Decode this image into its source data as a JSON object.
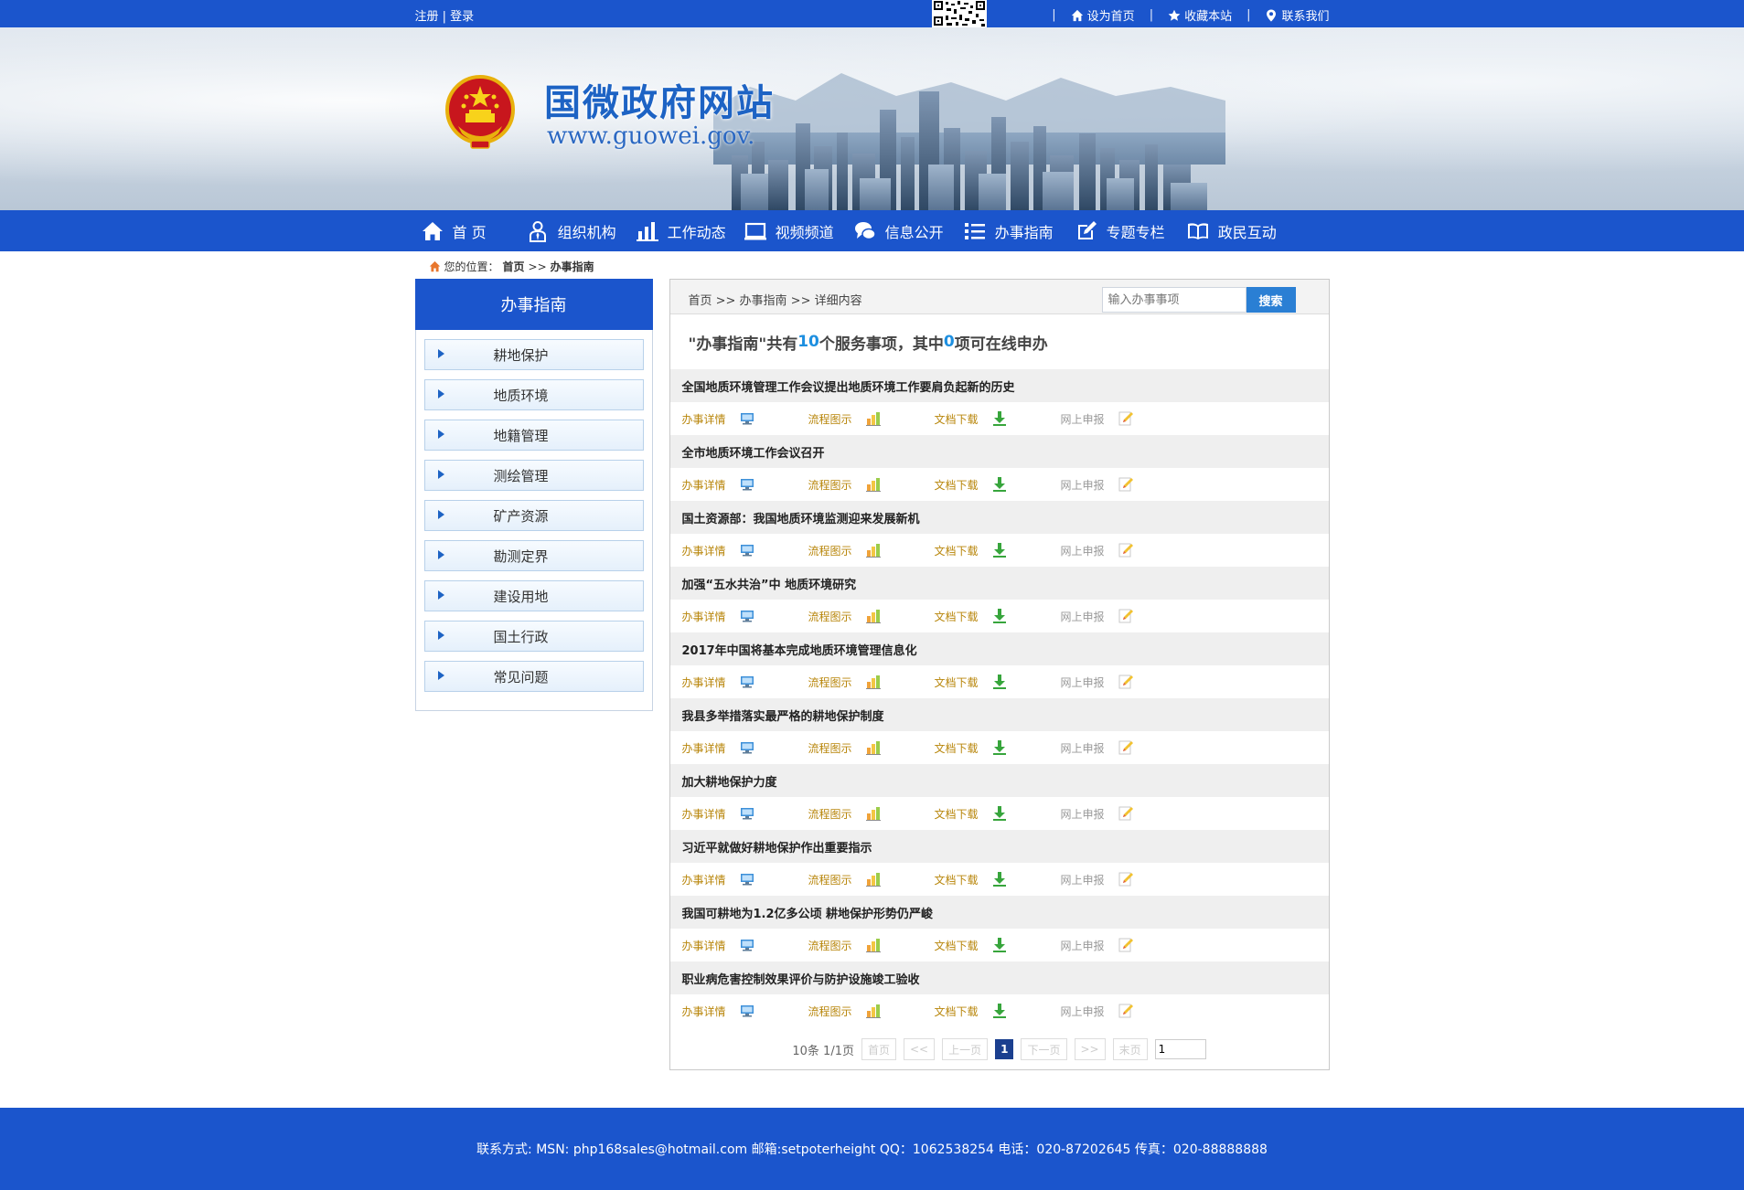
{
  "topbar": {
    "register": "注册",
    "separator": " | ",
    "login": "登录",
    "set_home": "设为首页",
    "favorite": "收藏本站",
    "contact": "联系我们",
    "divider": "|"
  },
  "banner": {
    "site_title": "国微政府网站",
    "site_url": "www.guowei.gov."
  },
  "nav": {
    "items": [
      {
        "label": "首 页",
        "icon": "home-icon"
      },
      {
        "label": "组织机构",
        "icon": "user-icon"
      },
      {
        "label": "工作动态",
        "icon": "bar-chart-icon"
      },
      {
        "label": "视频频道",
        "icon": "monitor-icon"
      },
      {
        "label": "信息公开",
        "icon": "chat-icon"
      },
      {
        "label": "办事指南",
        "icon": "list-icon"
      },
      {
        "label": "专题专栏",
        "icon": "edit-icon"
      },
      {
        "label": "政民互动",
        "icon": "book-icon"
      }
    ]
  },
  "breadcrumb": {
    "prefix": "您的位置：",
    "home": "首页",
    "sep": " >> ",
    "current": "办事指南"
  },
  "sidebar": {
    "title": "办事指南",
    "items": [
      "耕地保护",
      "地质环境",
      "地籍管理",
      "测绘管理",
      "矿产资源",
      "勘测定界",
      "建设用地",
      "国土行政",
      "常见问题"
    ]
  },
  "main": {
    "path": "首页 >> 办事指南 >> 详细内容",
    "search_placeholder": "输入办事事项",
    "search_button": "搜索",
    "summary": {
      "part1": "\"办事指南\"共有",
      "total": "10",
      "part2": "个服务事项，其中 ",
      "online": "0",
      "part3": "项可在线申办"
    },
    "action_labels": {
      "detail": "办事详情",
      "flow": "流程图示",
      "download": "文档下载",
      "online": "网上申报"
    },
    "items": [
      "全国地质环境管理工作会议提出地质环境工作要肩负起新的历史",
      "全市地质环境工作会议召开",
      "国土资源部：我国地质环境监测迎来发展新机",
      "加强“五水共治”中 地质环境研究",
      "2017年中国将基本完成地质环境管理信息化",
      "我县多举措落实最严格的耕地保护制度",
      "加大耕地保护力度",
      "习近平就做好耕地保护作出重要指示",
      "我国可耕地为1.2亿多公顷 耕地保护形势仍严峻",
      "职业病危害控制效果评价与防护设施竣工验收"
    ]
  },
  "pager": {
    "info": "10条 1/1页",
    "first": "首页",
    "prev_fast": "<<",
    "prev": "上一页",
    "current": "1",
    "next": "下一页",
    "next_fast": ">>",
    "last": "末页",
    "jump_value": "1"
  },
  "footer": {
    "text": "联系方式: MSN: php168sales@hotmail.com 邮箱:setpoterheight QQ：1062538254 电话：020-87202645 传真：020-88888888"
  },
  "colors": {
    "brand_blue": "#1b55cc",
    "accent_blue": "#1d8fe0",
    "action_gold": "#b8860b"
  }
}
